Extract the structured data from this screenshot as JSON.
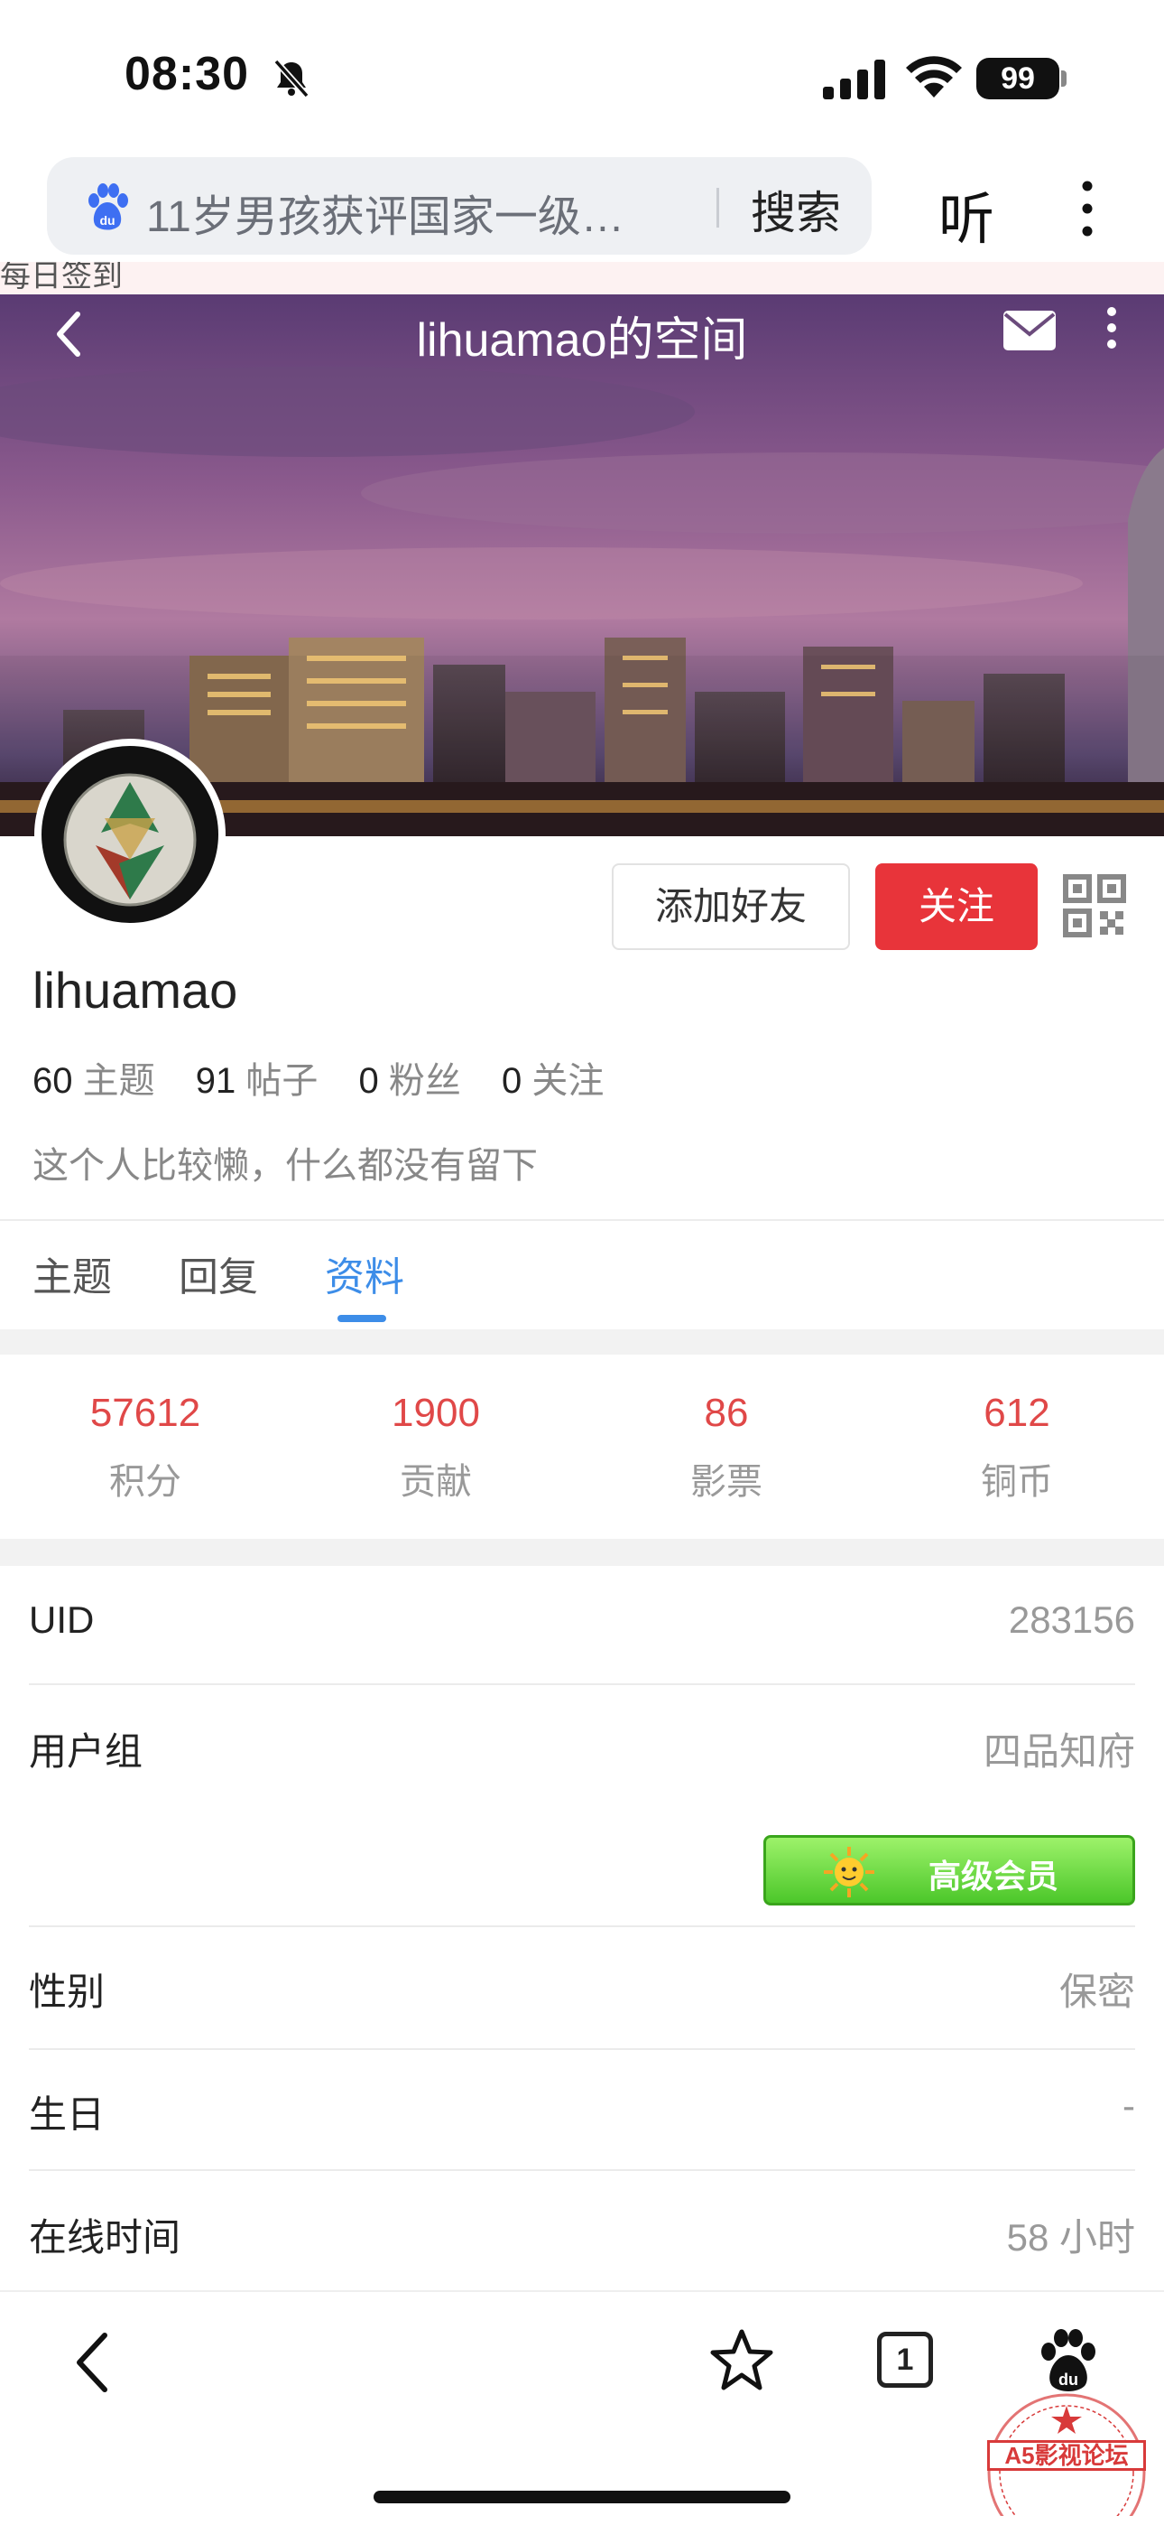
{
  "status_bar": {
    "time": "08:30",
    "battery": "99"
  },
  "browser": {
    "search_query": "11岁男孩获评国家一级…",
    "search_button": "搜索",
    "listen_button": "听"
  },
  "page": {
    "sign_strip": "每日签到",
    "title": "lihuamao的空间",
    "add_friend_label": "添加好友",
    "follow_label": "关注"
  },
  "profile": {
    "username": "lihuamao",
    "counts": [
      {
        "value": "60",
        "label": "主题"
      },
      {
        "value": "91",
        "label": "帖子"
      },
      {
        "value": "0",
        "label": "粉丝"
      },
      {
        "value": "0",
        "label": "关注"
      }
    ],
    "bio": "这个人比较懒，什么都没有留下"
  },
  "tabs": [
    {
      "label": "主题",
      "active": false
    },
    {
      "label": "回复",
      "active": false
    },
    {
      "label": "资料",
      "active": true
    }
  ],
  "stats": [
    {
      "value": "57612",
      "label": "积分"
    },
    {
      "value": "1900",
      "label": "贡献"
    },
    {
      "value": "86",
      "label": "影票"
    },
    {
      "value": "612",
      "label": "铜币"
    }
  ],
  "info_rows": [
    {
      "label": "UID",
      "value": "283156"
    },
    {
      "label": "用户组",
      "value": "四品知府"
    },
    {
      "label": "性别",
      "value": "保密"
    },
    {
      "label": "生日",
      "value": "-"
    },
    {
      "label": "在线时间",
      "value": "58 小时"
    }
  ],
  "vip_badge": "高级会员",
  "bottom_nav": {
    "tab_count": "1"
  },
  "watermark": "A5影视论坛",
  "colors": {
    "accent_blue": "#3d8de8",
    "follow_red": "#e8343a",
    "stat_red": "#e04848"
  }
}
